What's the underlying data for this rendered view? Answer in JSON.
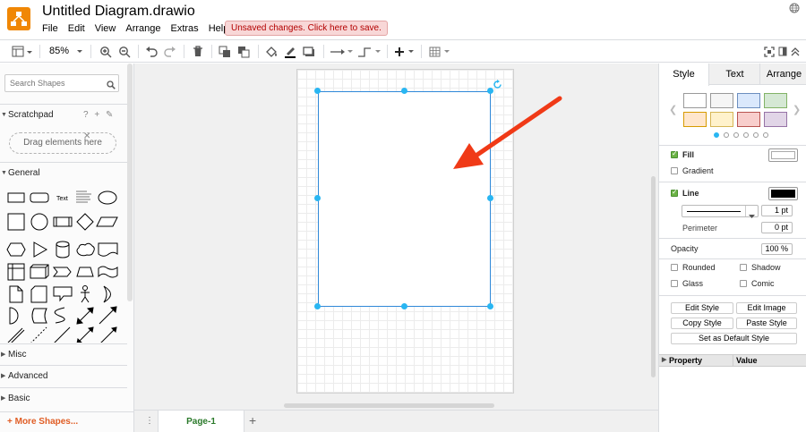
{
  "app": {
    "title": "Untitled Diagram.drawio",
    "unsaved_notice": "Unsaved changes. Click here to save.",
    "menu": [
      "File",
      "Edit",
      "View",
      "Arrange",
      "Extras",
      "Help"
    ]
  },
  "toolbar": {
    "zoom": "85%"
  },
  "left_panel": {
    "search_placeholder": "Search Shapes",
    "scratchpad_label": "Scratchpad",
    "scratchpad_icons": "? + ✎ ✕",
    "drag_hint": "Drag elements here",
    "general_label": "General",
    "shape_text_label": "Text",
    "sections": [
      "Misc",
      "Advanced",
      "Basic"
    ],
    "more_shapes": "+ More Shapes..."
  },
  "page_tabs": {
    "menu_icon": "⋮",
    "active_page": "Page-1",
    "add_icon": "+"
  },
  "right_panel": {
    "tabs": [
      "Style",
      "Text",
      "Arrange"
    ],
    "fill_label": "Fill",
    "gradient_label": "Gradient",
    "line_label": "Line",
    "line_width": "1 pt",
    "perimeter_label": "Perimeter",
    "perimeter_value": "0 pt",
    "opacity_label": "Opacity",
    "opacity_value": "100 %",
    "rounded_label": "Rounded",
    "shadow_label": "Shadow",
    "glass_label": "Glass",
    "comic_label": "Comic",
    "edit_style": "Edit Style",
    "edit_image": "Edit Image",
    "copy_style": "Copy Style",
    "paste_style": "Paste Style",
    "set_default_style": "Set as Default Style",
    "property_header": "Property",
    "value_header": "Value",
    "swatch_colors": [
      "#ffffff",
      "#f5f5f5",
      "#dae8fc",
      "#d5e8d4",
      "#ffe6cc",
      "#fff2cc",
      "#f8cecc",
      "#e1d5e7"
    ]
  },
  "colors": {
    "accent": "#29b6f2",
    "selection": "#2f88d8",
    "logo": "#f08705",
    "arrow": "#f03a17",
    "more_shapes": "#e05d25",
    "active_page": "#2b7a2b"
  }
}
